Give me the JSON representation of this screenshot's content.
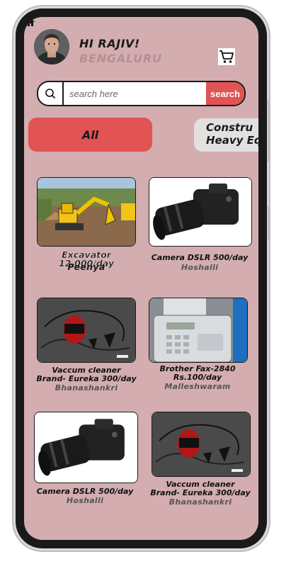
{
  "header": {
    "greeting": "HI RAJIV!",
    "city": "BENGALURU",
    "cart_icon": "cart-icon",
    "home_icon": "home-icon"
  },
  "search": {
    "placeholder": "search here",
    "button_label": "search",
    "icon": "search-icon"
  },
  "categories": [
    {
      "label": "All",
      "active": true
    },
    {
      "label": "Construction & Heavy Equipment",
      "visible_text_line1": "Constru",
      "visible_text_line2": "Heavy Eq",
      "active": false
    }
  ],
  "colors": {
    "background": "#d3adb0",
    "accent": "#e25353",
    "inactive_chip": "#e3e0e0"
  },
  "products": [
    {
      "title": "Excavator 12,000/day",
      "location": "Peenya",
      "image": "excavator"
    },
    {
      "title": "Camera DSLR 500/day",
      "location": "Hoshalli",
      "image": "dslr-camera"
    },
    {
      "title_line1": "Vaccum cleaner",
      "title_line2": "Brand- Eureka 300/day",
      "location": "Bhanashankri",
      "image": "vacuum-cleaner"
    },
    {
      "title_line1": "Brother Fax-2840",
      "title_line2": "Rs.100/day",
      "location": "Malleshwaram",
      "image": "fax-machine"
    },
    {
      "title": "Camera DSLR 500/day",
      "location": "Hoshalli",
      "image": "dslr-camera"
    },
    {
      "title_line1": "Vaccum cleaner",
      "title_line2": "Brand- Eureka 300/day",
      "location": "Bhanashankri",
      "image": "vacuum-cleaner"
    }
  ]
}
